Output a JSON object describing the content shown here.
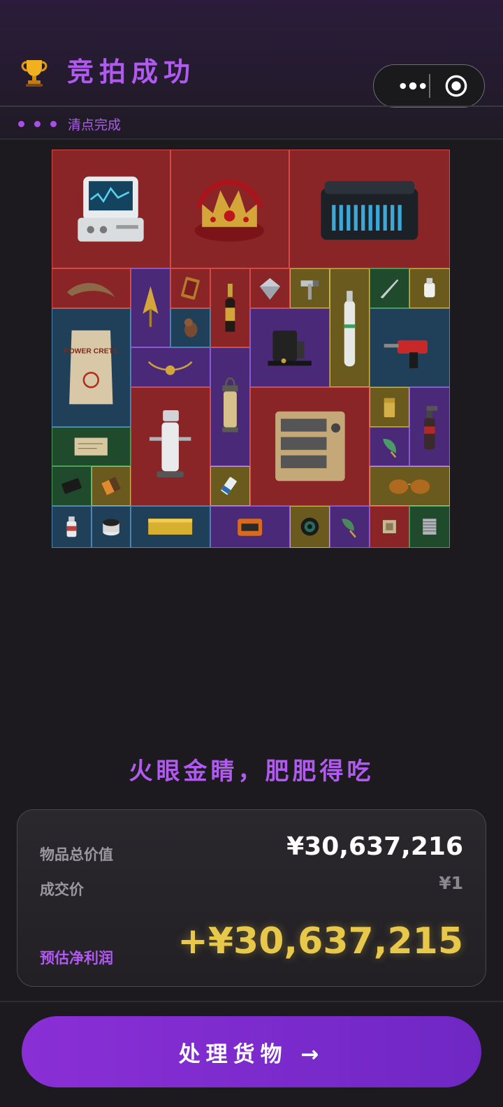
{
  "header": {
    "title": "竞拍成功",
    "status_text": "清点完成"
  },
  "items": [
    {
      "name": "medical-monitor",
      "rarity": "red"
    },
    {
      "name": "jeweled-crown",
      "rarity": "red"
    },
    {
      "name": "server-case",
      "rarity": "red"
    },
    {
      "name": "fossil-horn",
      "rarity": "red"
    },
    {
      "name": "gold-arrowhead",
      "rarity": "purple"
    },
    {
      "name": "tarot-card",
      "rarity": "red"
    },
    {
      "name": "champagne-bottle",
      "rarity": "red"
    },
    {
      "name": "diamond",
      "rarity": "red"
    },
    {
      "name": "pipe-wrench",
      "rarity": "gold"
    },
    {
      "name": "oxygen-tank",
      "rarity": "gold"
    },
    {
      "name": "scalpel",
      "rarity": "green"
    },
    {
      "name": "usb-drive",
      "rarity": "gold"
    },
    {
      "name": "cement-bag",
      "rarity": "blue",
      "label": "POWER CRETE"
    },
    {
      "name": "bird-figurine",
      "rarity": "blue"
    },
    {
      "name": "coffee-machine",
      "rarity": "purple"
    },
    {
      "name": "hammer-drill",
      "rarity": "blue"
    },
    {
      "name": "horned-necklace",
      "rarity": "purple"
    },
    {
      "name": "oil-lantern",
      "rarity": "purple"
    },
    {
      "name": "surgical-robot",
      "rarity": "red"
    },
    {
      "name": "armored-generator",
      "rarity": "red"
    },
    {
      "name": "zippo-lighter",
      "rarity": "gold"
    },
    {
      "name": "blowtorch",
      "rarity": "purple"
    },
    {
      "name": "old-map",
      "rarity": "green"
    },
    {
      "name": "leaf-arrowhead",
      "rarity": "purple"
    },
    {
      "name": "black-card",
      "rarity": "green"
    },
    {
      "name": "chocolate-bar",
      "rarity": "gold"
    },
    {
      "name": "cable-roll",
      "rarity": "gold"
    },
    {
      "name": "aviator-sunglasses",
      "rarity": "gold"
    },
    {
      "name": "medicine-bottle",
      "rarity": "blue"
    },
    {
      "name": "motor-coil",
      "rarity": "blue"
    },
    {
      "name": "gold-bar",
      "rarity": "blue"
    },
    {
      "name": "orange-case",
      "rarity": "purple"
    },
    {
      "name": "camera-lens",
      "rarity": "gold"
    },
    {
      "name": "spear-tip",
      "rarity": "purple"
    },
    {
      "name": "cpu-chip",
      "rarity": "red"
    },
    {
      "name": "cpu-cooler",
      "rarity": "green"
    }
  ],
  "slogan": "火眼金睛，肥肥得吃",
  "summary": {
    "total_label": "物品总价值",
    "total_value": "¥30,637,216",
    "deal_label": "成交价",
    "deal_value": "¥1",
    "profit_label": "预估净利润",
    "profit_value": "+¥30,637,215"
  },
  "action_button": "处理货物 →",
  "colors": {
    "accent_purple": "#b05af0",
    "profit_gold": "#e8c84a",
    "button_purple": "#8a2fd6"
  }
}
